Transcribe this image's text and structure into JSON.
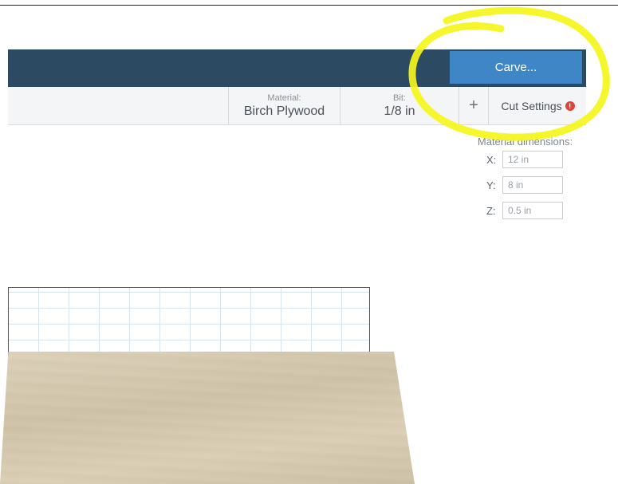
{
  "header": {
    "carve_label": "Carve..."
  },
  "toolbar": {
    "material_label": "Material:",
    "material_value": "Birch Plywood",
    "bit_label": "Bit:",
    "bit_value": "1/8 in",
    "add_label": "+",
    "cut_settings_label": "Cut Settings",
    "cut_settings_alert": "!"
  },
  "material_dimensions": {
    "title": "Material dimensions:",
    "fields": [
      {
        "axis": "X:",
        "value": "12 in"
      },
      {
        "axis": "Y:",
        "value": "8 in"
      },
      {
        "axis": "Z:",
        "value": "0.5 in"
      }
    ]
  },
  "colors": {
    "header_bg": "#2d4a63",
    "carve_button": "#3f86c7",
    "annotation_highlight": "#f5f51a",
    "plywood": "#d9cdb2",
    "alert": "#e0453a"
  },
  "icons": {
    "add": "plus-icon",
    "alert": "exclamation-circle-icon"
  }
}
